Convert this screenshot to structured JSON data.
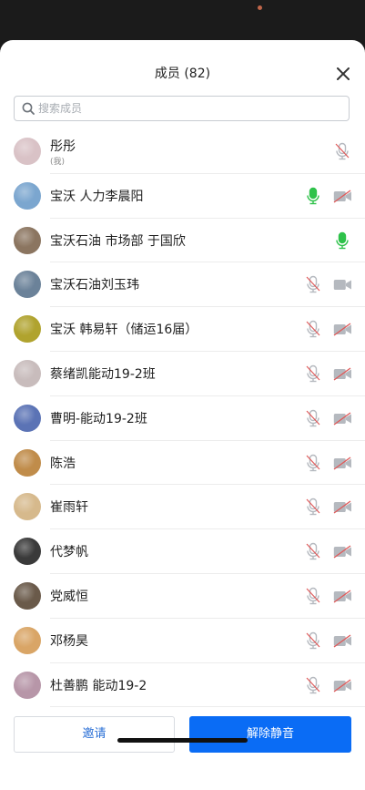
{
  "header": {
    "title": "成员 (82)",
    "close_icon": "close-icon"
  },
  "search": {
    "placeholder": "搜索成员",
    "value": ""
  },
  "members": [
    {
      "name": "彤彤",
      "sub": "(我)",
      "mic": "muted",
      "camera": "none",
      "avatar_color": "#d9c2c6"
    },
    {
      "name": "宝沃 人力李晨阳",
      "sub": "",
      "mic": "on",
      "camera": "off",
      "avatar_color": "#7ba6cf"
    },
    {
      "name": "宝沃石油 市场部 于国欣",
      "sub": "",
      "mic": "on",
      "camera": "none",
      "avatar_color": "#8b7560"
    },
    {
      "name": "宝沃石油刘玉玮",
      "sub": "",
      "mic": "muted",
      "camera": "on",
      "avatar_color": "#6b8299"
    },
    {
      "name": "宝沃 韩易轩（储运16届）",
      "sub": "",
      "mic": "muted",
      "camera": "off",
      "avatar_color": "#b0a32e"
    },
    {
      "name": "蔡绪凯能动19-2班",
      "sub": "",
      "mic": "muted",
      "camera": "off",
      "avatar_color": "#c8bcbc"
    },
    {
      "name": "曹明-能动19-2班",
      "sub": "",
      "mic": "muted",
      "camera": "off",
      "avatar_color": "#5b73b5"
    },
    {
      "name": "陈浩",
      "sub": "",
      "mic": "muted",
      "camera": "off",
      "avatar_color": "#c08c4a"
    },
    {
      "name": "崔雨轩",
      "sub": "",
      "mic": "muted",
      "camera": "off",
      "avatar_color": "#d6b98c"
    },
    {
      "name": "代梦帆",
      "sub": "",
      "mic": "muted",
      "camera": "off",
      "avatar_color": "#3a3a3a"
    },
    {
      "name": "党威恒",
      "sub": "",
      "mic": "muted",
      "camera": "off",
      "avatar_color": "#6a5a4a"
    },
    {
      "name": "邓杨昊",
      "sub": "",
      "mic": "muted",
      "camera": "off",
      "avatar_color": "#d9a566"
    },
    {
      "name": "杜善鹏 能动19-2",
      "sub": "",
      "mic": "muted",
      "camera": "off",
      "avatar_color": "#b796a8"
    }
  ],
  "footer": {
    "invite_label": "邀请",
    "unmute_label": "解除静音"
  },
  "colors": {
    "accent": "#0a6cf5",
    "mic_on": "#2ec24a",
    "muted": "#b5b9bf",
    "muted_slash": "#e05a5a"
  }
}
